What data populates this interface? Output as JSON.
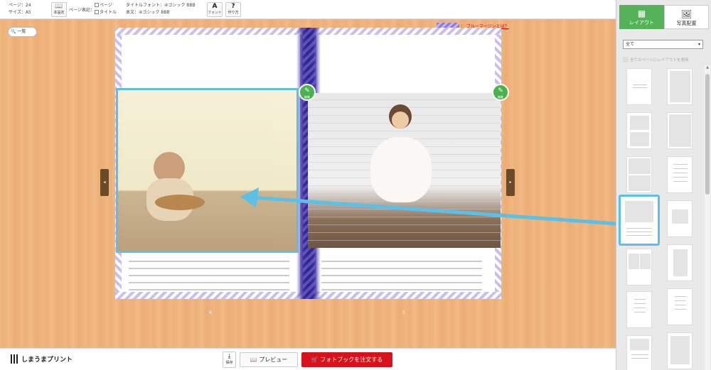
{
  "toolbar": {
    "page_label": "ページ：24",
    "size_label": "サイズ：A5",
    "book_settings_label": "本設定",
    "page_display_label": "ページ表記：",
    "page_checkbox_label": "ページ",
    "title_checkbox_label": "タイトル",
    "title_font_label": "タイトルフォント：④ゴシック BBB",
    "body_font_label": "本文：④ゴシック BBB",
    "font_button_label": "フォント",
    "howto_button_label": "作り方"
  },
  "workspace": {
    "list_button_label": "一覧",
    "blue_margin_colon": "：",
    "blue_margin_link": "ブルーマージンとは？",
    "left_page_number": "4",
    "right_page_number": "5",
    "edit_label": "編集"
  },
  "bottombar": {
    "logo_text": "しまうまプリント",
    "save_label": "保存",
    "preview_label": "プレビュー",
    "order_label": "フォトブックを注文する"
  },
  "panel": {
    "tabs": [
      {
        "label": "レイアウト",
        "active": true
      },
      {
        "label": "写真配置",
        "active": false
      }
    ],
    "filter_value": "全て",
    "apply_all_label": "全てのページにレイアウトを適用"
  },
  "colors": {
    "accent_green": "#56b15b",
    "order_red": "#d8111c",
    "highlight_blue": "#5bbfe6",
    "blue_margin": "#b8a8ee"
  }
}
